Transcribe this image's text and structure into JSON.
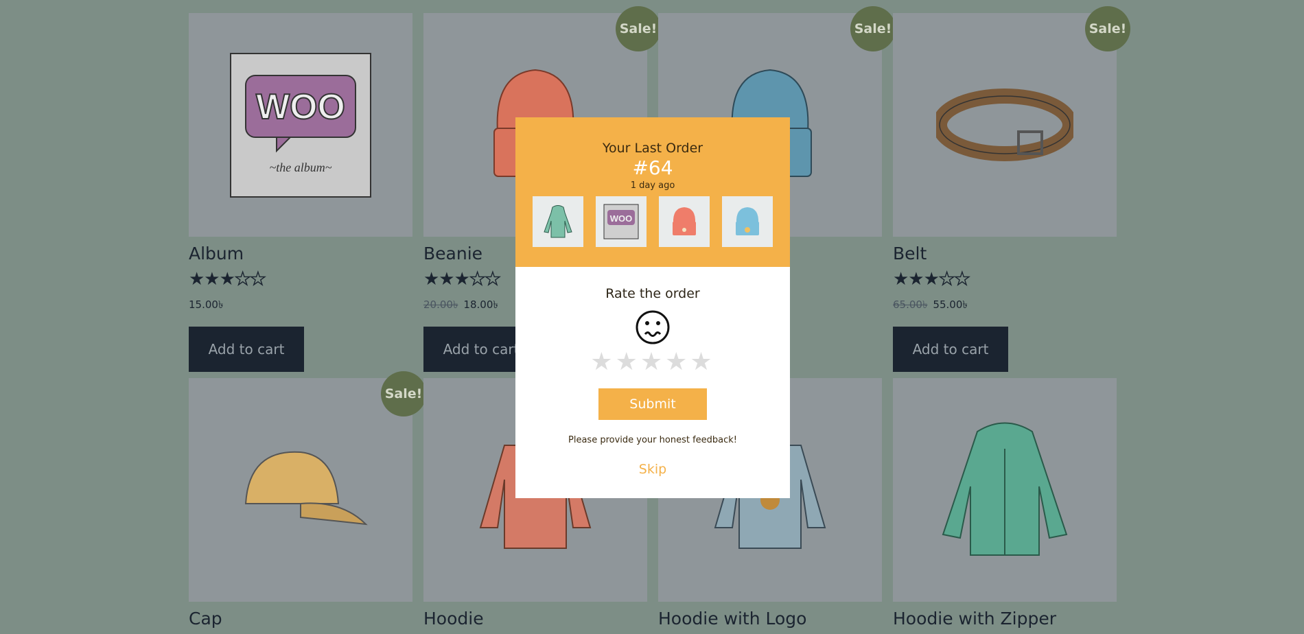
{
  "products": [
    {
      "name": "Album",
      "sale": false,
      "rating": 3,
      "old_price": "",
      "price": "15.00৳",
      "cta": "Add to cart",
      "icon": "album-image"
    },
    {
      "name": "Beanie",
      "sale": true,
      "sale_label": "Sale!",
      "rating": 3,
      "old_price": "20.00৳",
      "price": "18.00৳",
      "cta": "Add to cart",
      "icon": "beanie-image"
    },
    {
      "name": "",
      "sale": true,
      "sale_label": "Sale!",
      "rating": 0,
      "old_price": "",
      "price": "",
      "cta": "",
      "icon": "beanie-blue-image"
    },
    {
      "name": "Belt",
      "sale": true,
      "sale_label": "Sale!",
      "rating": 3,
      "old_price": "65.00৳",
      "price": "55.00৳",
      "cta": "Add to cart",
      "icon": "belt-image"
    },
    {
      "name": "Cap",
      "sale": true,
      "sale_label": "Sale!",
      "icon": "cap-image"
    },
    {
      "name": "Hoodie",
      "sale": false,
      "icon": "hoodie-image"
    },
    {
      "name": "Hoodie with Logo",
      "sale": false,
      "icon": "hoodie-logo-image"
    },
    {
      "name": "Hoodie with Zipper",
      "sale": false,
      "icon": "hoodie-zipper-image"
    }
  ],
  "modal": {
    "title": "Your Last Order",
    "order_number": "#64",
    "time_ago": "1 day ago",
    "thumbnails": [
      "hoodie-zipper-thumb",
      "album-thumb",
      "beanie-thumb",
      "beanie-blue-thumb"
    ],
    "rate_label": "Rate the order",
    "face_icon": "worried-face-icon",
    "rating_value": 0,
    "rating_max": 5,
    "submit_label": "Submit",
    "feedback_text": "Please provide your honest feedback!",
    "skip_label": "Skip"
  },
  "colors": {
    "overlay_bg": "#7d8e86",
    "modal_accent": "#f4b149",
    "sale_badge": "#5f6e4b",
    "button_dark": "#1b2430"
  }
}
